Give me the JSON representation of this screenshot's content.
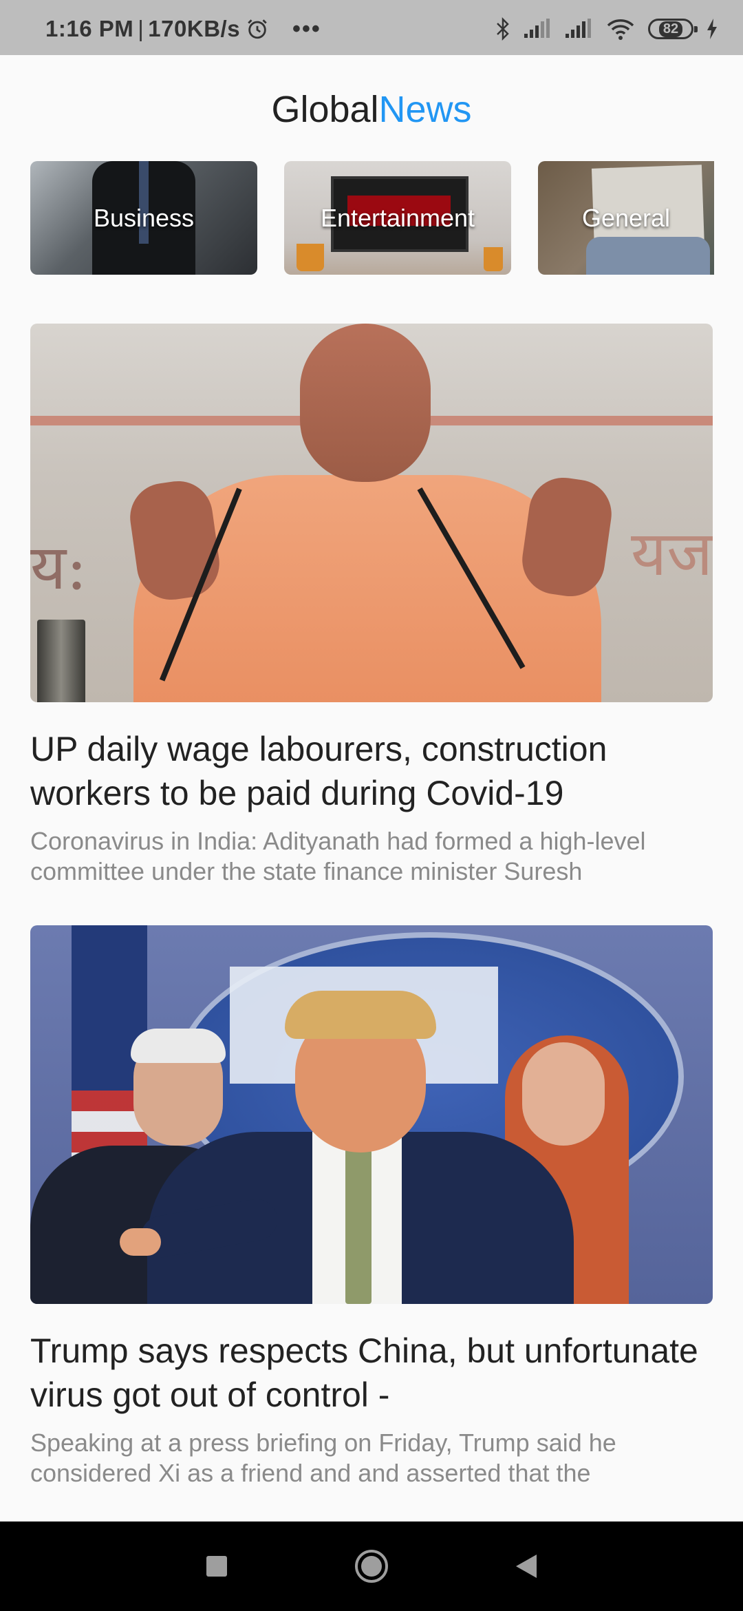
{
  "status_bar": {
    "time": "1:16 PM",
    "separator": "|",
    "speed": "170KB/s",
    "more": "•••",
    "battery": "82"
  },
  "app": {
    "title_part1": "Global",
    "title_part2": "News",
    "accent_color": "#2196f3"
  },
  "categories": [
    {
      "label": "Business"
    },
    {
      "label": "Entertainment"
    },
    {
      "label": "General"
    }
  ],
  "articles": [
    {
      "title": "UP daily wage labourers, construction workers to be paid during Covid-19",
      "description": "Coronavirus in India: Adityanath had formed a high-level committee under the state finance minister Suresh"
    },
    {
      "title": "Trump says respects China, but unfortunate virus got out of control -",
      "description": "Speaking at a press briefing on Friday, Trump said he considered Xi as a friend and and asserted that the"
    }
  ],
  "nav": {
    "icons": [
      "recents-icon",
      "home-icon",
      "back-icon"
    ]
  }
}
